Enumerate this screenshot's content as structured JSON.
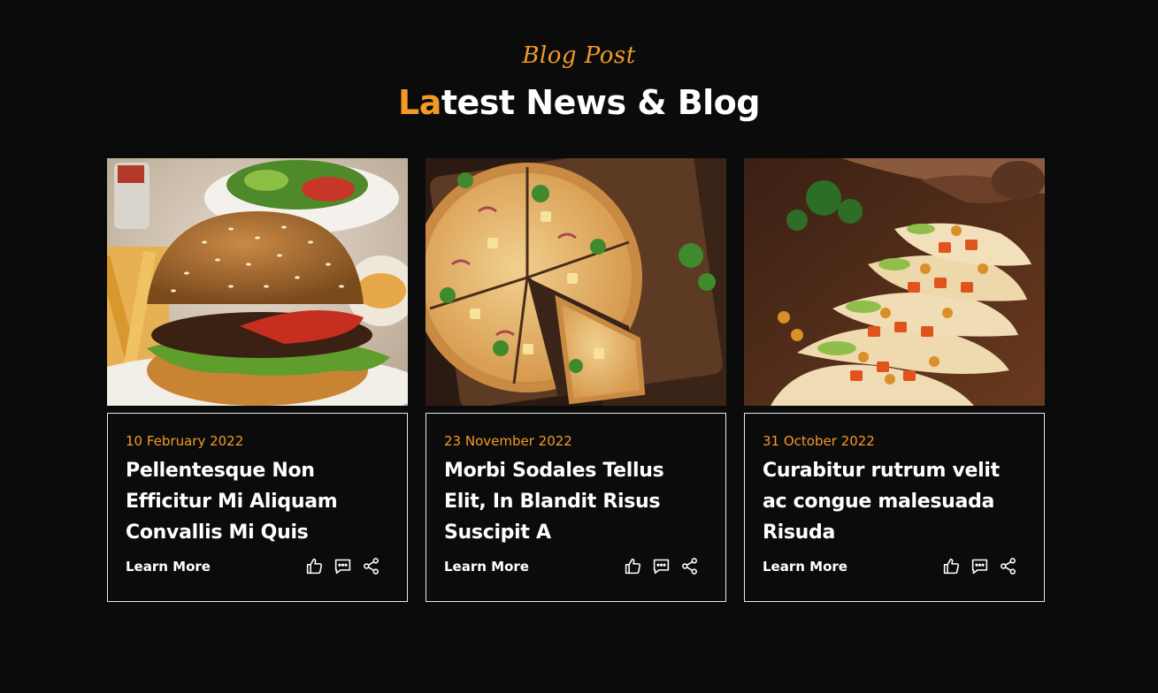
{
  "section": {
    "subtitle": "Blog Post",
    "heading_accent": "La",
    "heading_rest": "test News & Blog"
  },
  "colors": {
    "background": "#0b0b0b",
    "accent": "#f39a26",
    "text": "#ffffff",
    "card_border": "#e8e8e8"
  },
  "posts": [
    {
      "image": "burger-photo",
      "date": "10 February 2022",
      "title": "Pellentesque Non Efficitur Mi Aliquam Convallis Mi Quis",
      "link_label": "Learn More",
      "actions": [
        "like-icon",
        "comment-icon",
        "share-icon"
      ]
    },
    {
      "image": "pizza-photo",
      "date": "23 November 2022",
      "title": "Morbi Sodales Tellus Elit, In Blandit Risus Suscipit A",
      "link_label": "Learn More",
      "actions": [
        "like-icon",
        "comment-icon",
        "share-icon"
      ]
    },
    {
      "image": "tacos-photo",
      "date": "31 October 2022",
      "title": "Curabitur rutrum velit ac congue malesuada Risuda",
      "link_label": "Learn More",
      "actions": [
        "like-icon",
        "comment-icon",
        "share-icon"
      ]
    }
  ]
}
